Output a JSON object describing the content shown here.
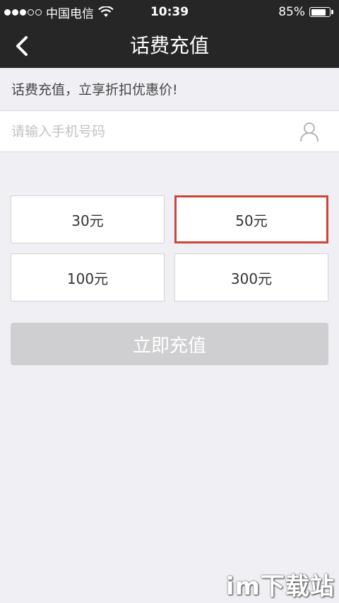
{
  "status_bar": {
    "carrier": "中国电信",
    "time": "10:39",
    "battery_percent": "85%",
    "battery_level": 0.85,
    "signal_bars_filled": 3,
    "signal_bars_total": 5
  },
  "nav": {
    "title": "话费充值",
    "back_icon": "chevron-left-icon"
  },
  "promo": {
    "text": "话费充值，立享折扣优惠价!"
  },
  "phone_input": {
    "placeholder": "请输入手机号码",
    "value": "",
    "contact_icon": "person-icon"
  },
  "amounts": {
    "options": [
      {
        "label": "30元",
        "selected": false
      },
      {
        "label": "50元",
        "selected": true
      },
      {
        "label": "100元",
        "selected": false
      },
      {
        "label": "300元",
        "selected": false
      }
    ],
    "selected_color": "#c8473a"
  },
  "submit": {
    "label": "立即充值",
    "enabled": false
  },
  "watermark": {
    "text": "im下载站"
  }
}
